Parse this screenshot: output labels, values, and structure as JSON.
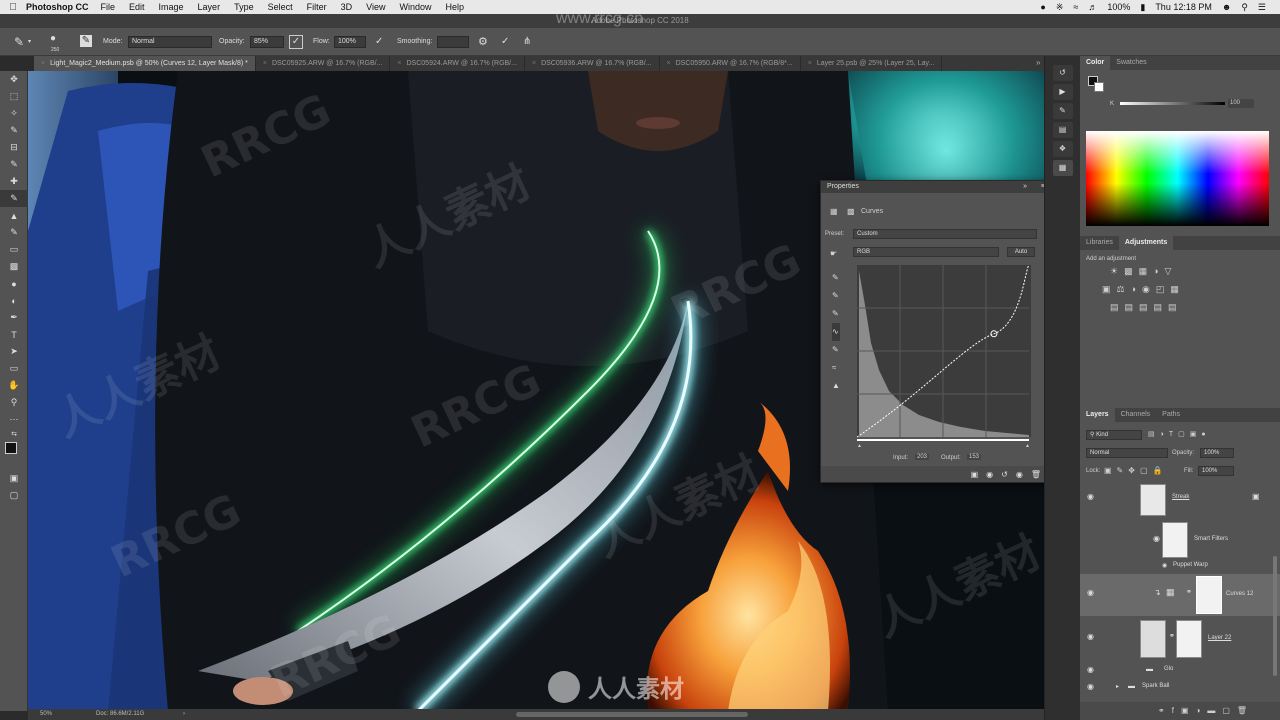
{
  "menubar": {
    "app": "Photoshop CC",
    "items": [
      "File",
      "Edit",
      "Image",
      "Layer",
      "Type",
      "Select",
      "Filter",
      "3D",
      "View",
      "Window",
      "Help"
    ],
    "battery": "100%",
    "clock": "Thu 12:18 PM"
  },
  "window_title": "Adobe Photoshop CC 2018",
  "watermark_url": "www.rrcg.cn",
  "options": {
    "brush_size": "250",
    "mode_label": "Mode:",
    "mode_value": "Normal",
    "opacity_label": "Opacity:",
    "opacity_value": "85%",
    "flow_label": "Flow:",
    "flow_value": "100%",
    "smoothing_label": "Smoothing:",
    "smoothing_value": ""
  },
  "tabs": [
    {
      "label": "Light_Magic2_Medium.psb @ 50% (Curves 12, Layer Mask/8) *",
      "active": true
    },
    {
      "label": "DSC05925.ARW @ 16.7% (RGB/...",
      "active": false
    },
    {
      "label": "DSC05924.ARW @ 16.7% (RGB/...",
      "active": false
    },
    {
      "label": "DSC05936.ARW @ 16.7% (RGB/...",
      "active": false
    },
    {
      "label": "DSC05950.ARW @ 16.7% (RGB/8*...",
      "active": false
    },
    {
      "label": "Layer 25.psb @ 25% (Layer 25, Lay...",
      "active": false
    }
  ],
  "status": {
    "zoom": "50%",
    "doc": "Doc: 86.6M/2.11G"
  },
  "properties": {
    "title": "Properties",
    "section": "Curves",
    "preset_label": "Preset:",
    "preset_value": "Custom",
    "channel_value": "RGB",
    "auto_label": "Auto",
    "input_label": "Input:",
    "input_value": "203",
    "output_label": "Output:",
    "output_value": "153"
  },
  "color_panel": {
    "tabs": [
      "Color",
      "Swatches"
    ],
    "k_value": "100"
  },
  "adjust_panel": {
    "tabs": [
      "Libraries",
      "Adjustments"
    ],
    "hint": "Add an adjustment"
  },
  "layers_panel": {
    "tabs": [
      "Layers",
      "Channels",
      "Paths"
    ],
    "kind": "Kind",
    "blend": "Normal",
    "opacity_label": "Opacity:",
    "opacity": "100%",
    "lock_label": "Lock:",
    "fill_label": "Fill:",
    "fill": "100%",
    "layers": [
      {
        "name": "Streak"
      },
      {
        "name": "Smart Filters"
      },
      {
        "name": "Puppet Warp"
      },
      {
        "name": "Curves 12"
      },
      {
        "name": "Layer 22"
      },
      {
        "name": "Glo"
      },
      {
        "name": "Spark Ball"
      }
    ]
  },
  "watermarks": [
    "RRCG",
    "人人素材",
    "RRCG",
    "人人素材",
    "RRCG",
    "人人素材",
    "RRCG",
    "人人素材",
    "RRCG"
  ],
  "bottom_brand": "人人素材",
  "curve": {
    "point_input": 203,
    "point_output": 153
  }
}
